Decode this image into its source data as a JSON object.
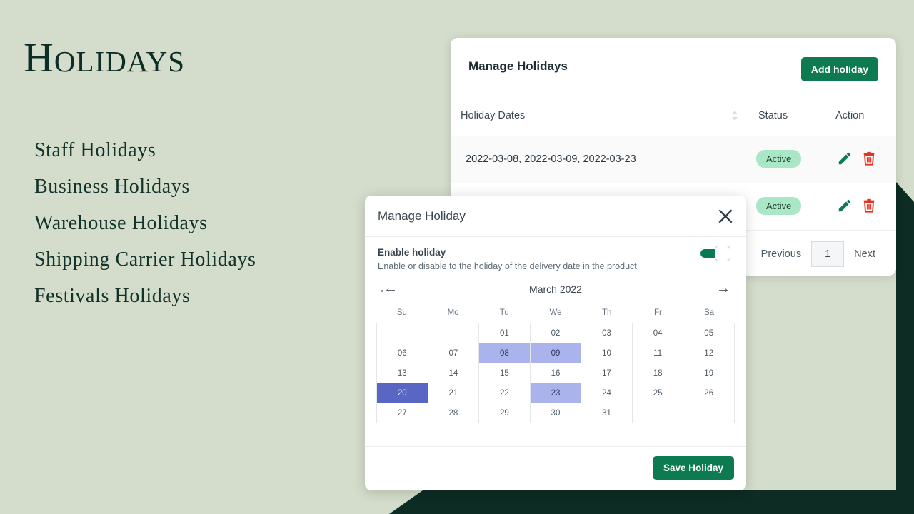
{
  "theme": {
    "background": "#d4dccb",
    "dark_shape": "#0c2c24",
    "accent_green": "#0e7a52",
    "badge_bg": "#a9e7c6",
    "calendar_selected": "#aab3ec",
    "calendar_today": "#5a66c4",
    "delete_red": "#e8301f",
    "title_color": "#0d2e26"
  },
  "left": {
    "title": "Holidays",
    "items": [
      {
        "label": "Staff Holidays"
      },
      {
        "label": "Business Holidays"
      },
      {
        "label": "Warehouse Holidays"
      },
      {
        "label": "Shipping Carrier Holidays"
      },
      {
        "label": "Festivals Holidays"
      }
    ]
  },
  "card": {
    "title": "Manage Holidays",
    "add_button": "Add holiday",
    "columns": {
      "dates": "Holiday Dates",
      "status": "Status",
      "action": "Action",
      "sort_icon": "sort-arrows-icon"
    },
    "rows": [
      {
        "dates": "2022-03-08, 2022-03-09, 2022-03-23",
        "status": "Active",
        "edit_icon": "pencil-icon",
        "delete_icon": "trash-icon"
      },
      {
        "dates": "",
        "status": "Active",
        "edit_icon": "pencil-icon",
        "delete_icon": "trash-icon"
      }
    ],
    "pagination": {
      "previous": "Previous",
      "page": "1",
      "next": "Next"
    }
  },
  "modal": {
    "title": "Manage Holiday",
    "close_icon": "close-icon",
    "enable": {
      "label": "Enable holiday",
      "description": "Enable or disable to the holiday of the delivery date in the product",
      "toggle_state": "on"
    },
    "calendar": {
      "month": "March 2022",
      "prev_icon": "arrow-left-icon",
      "next_icon": "arrow-right-icon",
      "weekdays": [
        "Su",
        "Mo",
        "Tu",
        "We",
        "Th",
        "Fr",
        "Sa"
      ],
      "cells": [
        {
          "label": "",
          "state": "empty"
        },
        {
          "label": "",
          "state": "empty"
        },
        {
          "label": "01",
          "state": "normal"
        },
        {
          "label": "02",
          "state": "normal"
        },
        {
          "label": "03",
          "state": "normal"
        },
        {
          "label": "04",
          "state": "normal"
        },
        {
          "label": "05",
          "state": "normal"
        },
        {
          "label": "06",
          "state": "normal"
        },
        {
          "label": "07",
          "state": "normal"
        },
        {
          "label": "08",
          "state": "selected"
        },
        {
          "label": "09",
          "state": "selected"
        },
        {
          "label": "10",
          "state": "normal"
        },
        {
          "label": "11",
          "state": "normal"
        },
        {
          "label": "12",
          "state": "normal"
        },
        {
          "label": "13",
          "state": "normal"
        },
        {
          "label": "14",
          "state": "normal"
        },
        {
          "label": "15",
          "state": "normal"
        },
        {
          "label": "16",
          "state": "normal"
        },
        {
          "label": "17",
          "state": "normal"
        },
        {
          "label": "18",
          "state": "normal"
        },
        {
          "label": "19",
          "state": "normal"
        },
        {
          "label": "20",
          "state": "today"
        },
        {
          "label": "21",
          "state": "normal"
        },
        {
          "label": "22",
          "state": "normal"
        },
        {
          "label": "23",
          "state": "selected"
        },
        {
          "label": "24",
          "state": "normal"
        },
        {
          "label": "25",
          "state": "normal"
        },
        {
          "label": "26",
          "state": "normal"
        },
        {
          "label": "27",
          "state": "normal"
        },
        {
          "label": "28",
          "state": "normal"
        },
        {
          "label": "29",
          "state": "normal"
        },
        {
          "label": "30",
          "state": "normal"
        },
        {
          "label": "31",
          "state": "normal"
        },
        {
          "label": "",
          "state": "empty"
        },
        {
          "label": "",
          "state": "empty"
        }
      ]
    },
    "save_button": "Save Holiday"
  }
}
